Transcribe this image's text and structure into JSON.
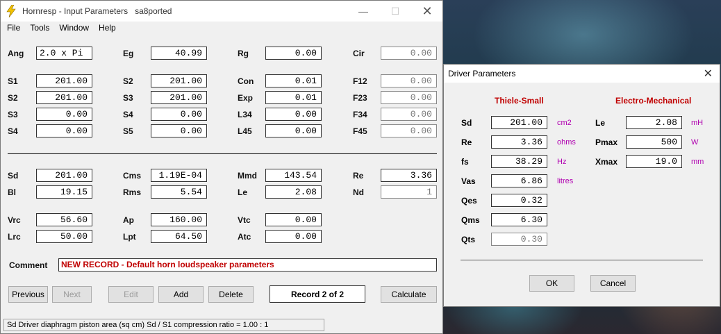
{
  "app": {
    "title": "Hornresp - Input Parameters",
    "record_name": "sa8ported"
  },
  "menu": [
    "File",
    "Tools",
    "Window",
    "Help"
  ],
  "params_top": [
    {
      "label": "Ang",
      "value": "2.0 x Pi"
    },
    {
      "label": "Eg",
      "value": "40.99"
    },
    {
      "label": "Rg",
      "value": "0.00"
    },
    {
      "label": "Cir",
      "value": "0.00"
    },
    {
      "label": "S1",
      "value": "201.00"
    },
    {
      "label": "S2",
      "value": "201.00"
    },
    {
      "label": "Con",
      "value": "0.01"
    },
    {
      "label": "F12",
      "value": "0.00"
    },
    {
      "label": "S2",
      "value": "201.00"
    },
    {
      "label": "S3",
      "value": "201.00"
    },
    {
      "label": "Exp",
      "value": "0.01"
    },
    {
      "label": "F23",
      "value": "0.00"
    },
    {
      "label": "S3",
      "value": "0.00"
    },
    {
      "label": "S4",
      "value": "0.00"
    },
    {
      "label": "L34",
      "value": "0.00"
    },
    {
      "label": "F34",
      "value": "0.00"
    },
    {
      "label": "S4",
      "value": "0.00"
    },
    {
      "label": "S5",
      "value": "0.00"
    },
    {
      "label": "L45",
      "value": "0.00"
    },
    {
      "label": "F45",
      "value": "0.00"
    }
  ],
  "params_bottom": [
    {
      "label": "Sd",
      "value": "201.00"
    },
    {
      "label": "Cms",
      "value": "1.19E-04"
    },
    {
      "label": "Mmd",
      "value": "143.54"
    },
    {
      "label": "Re",
      "value": "3.36"
    },
    {
      "label": "Bl",
      "value": "19.15"
    },
    {
      "label": "Rms",
      "value": "5.54"
    },
    {
      "label": "Le",
      "value": "2.08"
    },
    {
      "label": "Nd",
      "value": "1"
    },
    {
      "label": "Vrc",
      "value": "56.60"
    },
    {
      "label": "Ap",
      "value": "160.00"
    },
    {
      "label": "Vtc",
      "value": "0.00"
    },
    {
      "label": "Lrc",
      "value": "50.00"
    },
    {
      "label": "Lpt",
      "value": "64.50"
    },
    {
      "label": "Atc",
      "value": "0.00"
    }
  ],
  "comment": {
    "label": "Comment",
    "value": "NEW RECORD - Default horn loudspeaker parameters"
  },
  "buttons": {
    "previous": "Previous",
    "next": "Next",
    "edit": "Edit",
    "add": "Add",
    "delete": "Delete",
    "record": "Record 2 of 2",
    "calculate": "Calculate"
  },
  "status": "Sd   Driver diaphragm piston area  (sq cm)   Sd / S1 compression ratio = 1.00 : 1",
  "dialog": {
    "title": "Driver Parameters",
    "section_ts": "Thiele-Small",
    "section_em": "Electro-Mechanical",
    "ts_params": [
      {
        "label": "Sd",
        "value": "201.00",
        "unit": "cm2"
      },
      {
        "label": "Re",
        "value": "3.36",
        "unit": "ohms"
      },
      {
        "label": "fs",
        "value": "38.29",
        "unit": "Hz"
      },
      {
        "label": "Vas",
        "value": "6.86",
        "unit": "litres"
      },
      {
        "label": "Qes",
        "value": "0.32",
        "unit": ""
      },
      {
        "label": "Qms",
        "value": "6.30",
        "unit": ""
      },
      {
        "label": "Qts",
        "value": "0.30",
        "unit": ""
      }
    ],
    "em_params": [
      {
        "label": "Le",
        "value": "2.08",
        "unit": "mH"
      },
      {
        "label": "Pmax",
        "value": "500",
        "unit": "W"
      },
      {
        "label": "Xmax",
        "value": "19.0",
        "unit": "mm"
      }
    ],
    "ok": "OK",
    "cancel": "Cancel"
  },
  "colors": {
    "accent_red": "#c00000",
    "unit_magenta": "#b000b0",
    "window_bg": "#f0f0f0"
  }
}
